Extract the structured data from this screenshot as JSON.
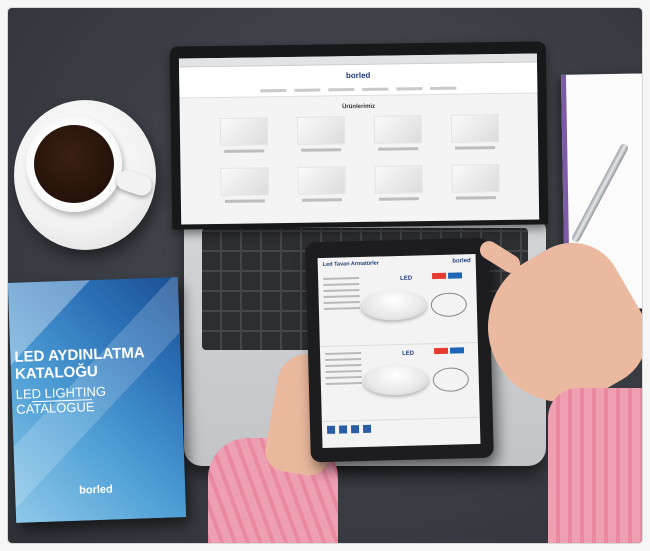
{
  "scene": {
    "catalogue": {
      "title_line1": "LED AYDINLATMA",
      "title_line2": "KATALOĞU",
      "subtitle_line1": "LED LIGHTING",
      "subtitle_line2": "CATALOGUE",
      "brand": "borled"
    },
    "laptop_screen": {
      "logo": "borled",
      "page_heading": "Ürünlerimiz",
      "product_count": 8
    },
    "tablet_screen": {
      "heading": "Led Tavan Armatürler",
      "logo": "borled",
      "badge_label": "LED"
    }
  }
}
